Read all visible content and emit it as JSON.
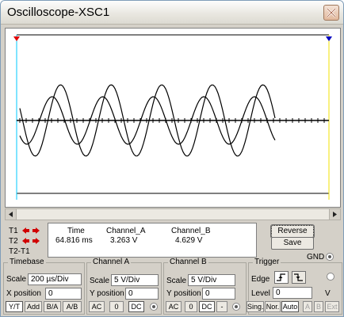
{
  "window": {
    "title": "Oscilloscope-XSC1"
  },
  "readout": {
    "headers": {
      "time": "Time",
      "channel_a": "Channel_A",
      "channel_b": "Channel_B"
    },
    "values": {
      "time": "64.816 ms",
      "channel_a": "3.263 V",
      "channel_b": "4.629 V"
    },
    "t1": "T1",
    "t2": "T2",
    "t2_t1": "T2-T1"
  },
  "buttons": {
    "reverse": "Reverse",
    "save": "Save",
    "gnd": "GND"
  },
  "timebase": {
    "title": "Timebase",
    "scale_label": "Scale",
    "scale": "200 µs/Div",
    "xpos_label": "X position",
    "xpos": "0",
    "modes": [
      "Y/T",
      "Add",
      "B/A",
      "A/B"
    ]
  },
  "channel_a": {
    "title": "Channel A",
    "scale_label": "Scale",
    "scale": "5  V/Div",
    "ypos_label": "Y position",
    "ypos": "0",
    "coupling": [
      "AC",
      "0",
      "DC"
    ]
  },
  "channel_b": {
    "title": "Channel B",
    "scale_label": "Scale",
    "scale": "5  V/Div",
    "ypos_label": "Y position",
    "ypos": "0",
    "coupling": [
      "AC",
      "0",
      "DC",
      "-"
    ]
  },
  "trigger": {
    "title": "Trigger",
    "edge_label": "Edge",
    "level_label": "Level",
    "level": "0",
    "level_unit": "V",
    "modes": [
      "Sing.",
      "Nor.",
      "Auto",
      "A",
      "B",
      "Ext"
    ]
  },
  "colors": {
    "cursor_t1": "#00c8ff",
    "cursor_t2": "#f0e000",
    "marker_t1": "#e00000",
    "marker_t2": "#0000c0",
    "trace": "#000000"
  },
  "chart_data": {
    "type": "line",
    "series": [
      {
        "label": "A",
        "amplitude_div": 1.8,
        "cycles_visible": 5.0,
        "phase_deg": 160
      },
      {
        "label": "B",
        "amplitude_div": 1.2,
        "cycles_visible": 5.0,
        "phase_deg": 220
      }
    ],
    "grid": false,
    "divisions_x": 10,
    "divisions_y": 8
  }
}
